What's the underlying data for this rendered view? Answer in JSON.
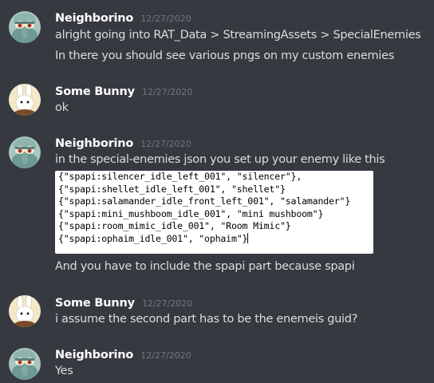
{
  "messages": [
    {
      "author": "Neighborino",
      "timestamp": "12/27/2020",
      "lines": [
        "alright going into RAT_Data > StreamingAssets > SpecialEnemies",
        "In there you should see various pngs on my custom enemies"
      ]
    },
    {
      "author": "Some Bunny",
      "timestamp": "12/27/2020",
      "lines": [
        "ok"
      ]
    },
    {
      "author": "Neighborino",
      "timestamp": "12/27/2020",
      "lines": [
        "in the special-enemies json you set up your enemy like this"
      ],
      "code": [
        "{\"spapi:silencer_idle_left_001\", \"silencer\"},",
        "{\"spapi:shellet_idle_left_001\", \"shellet\"}",
        "{\"spapi:salamander_idle_front_left_001\", \"salamander\"}",
        "{\"spapi:mini_mushboom_idle_001\", \"mini mushboom\"}",
        "{\"spapi:room_mimic_idle_001\", \"Room Mimic\"}",
        "{\"spapi:ophaim_idle_001\", \"ophaim\"}"
      ],
      "after_code": "And you have to include the spapi part because spapi"
    },
    {
      "author": "Some Bunny",
      "timestamp": "12/27/2020",
      "lines": [
        "i assume the second part has to be the enemeis guid?"
      ]
    },
    {
      "author": "Neighborino",
      "timestamp": "12/27/2020",
      "lines": [
        "Yes"
      ]
    }
  ],
  "colors": {
    "background": "#36393f",
    "username": "#ffffff",
    "timestamp": "#72767d",
    "text": "#dcddde",
    "code_background": "#ffffff"
  },
  "icons": {
    "neighborino_avatar": "squidward-avatar-icon",
    "bunny_avatar": "bunny-avatar-icon"
  }
}
